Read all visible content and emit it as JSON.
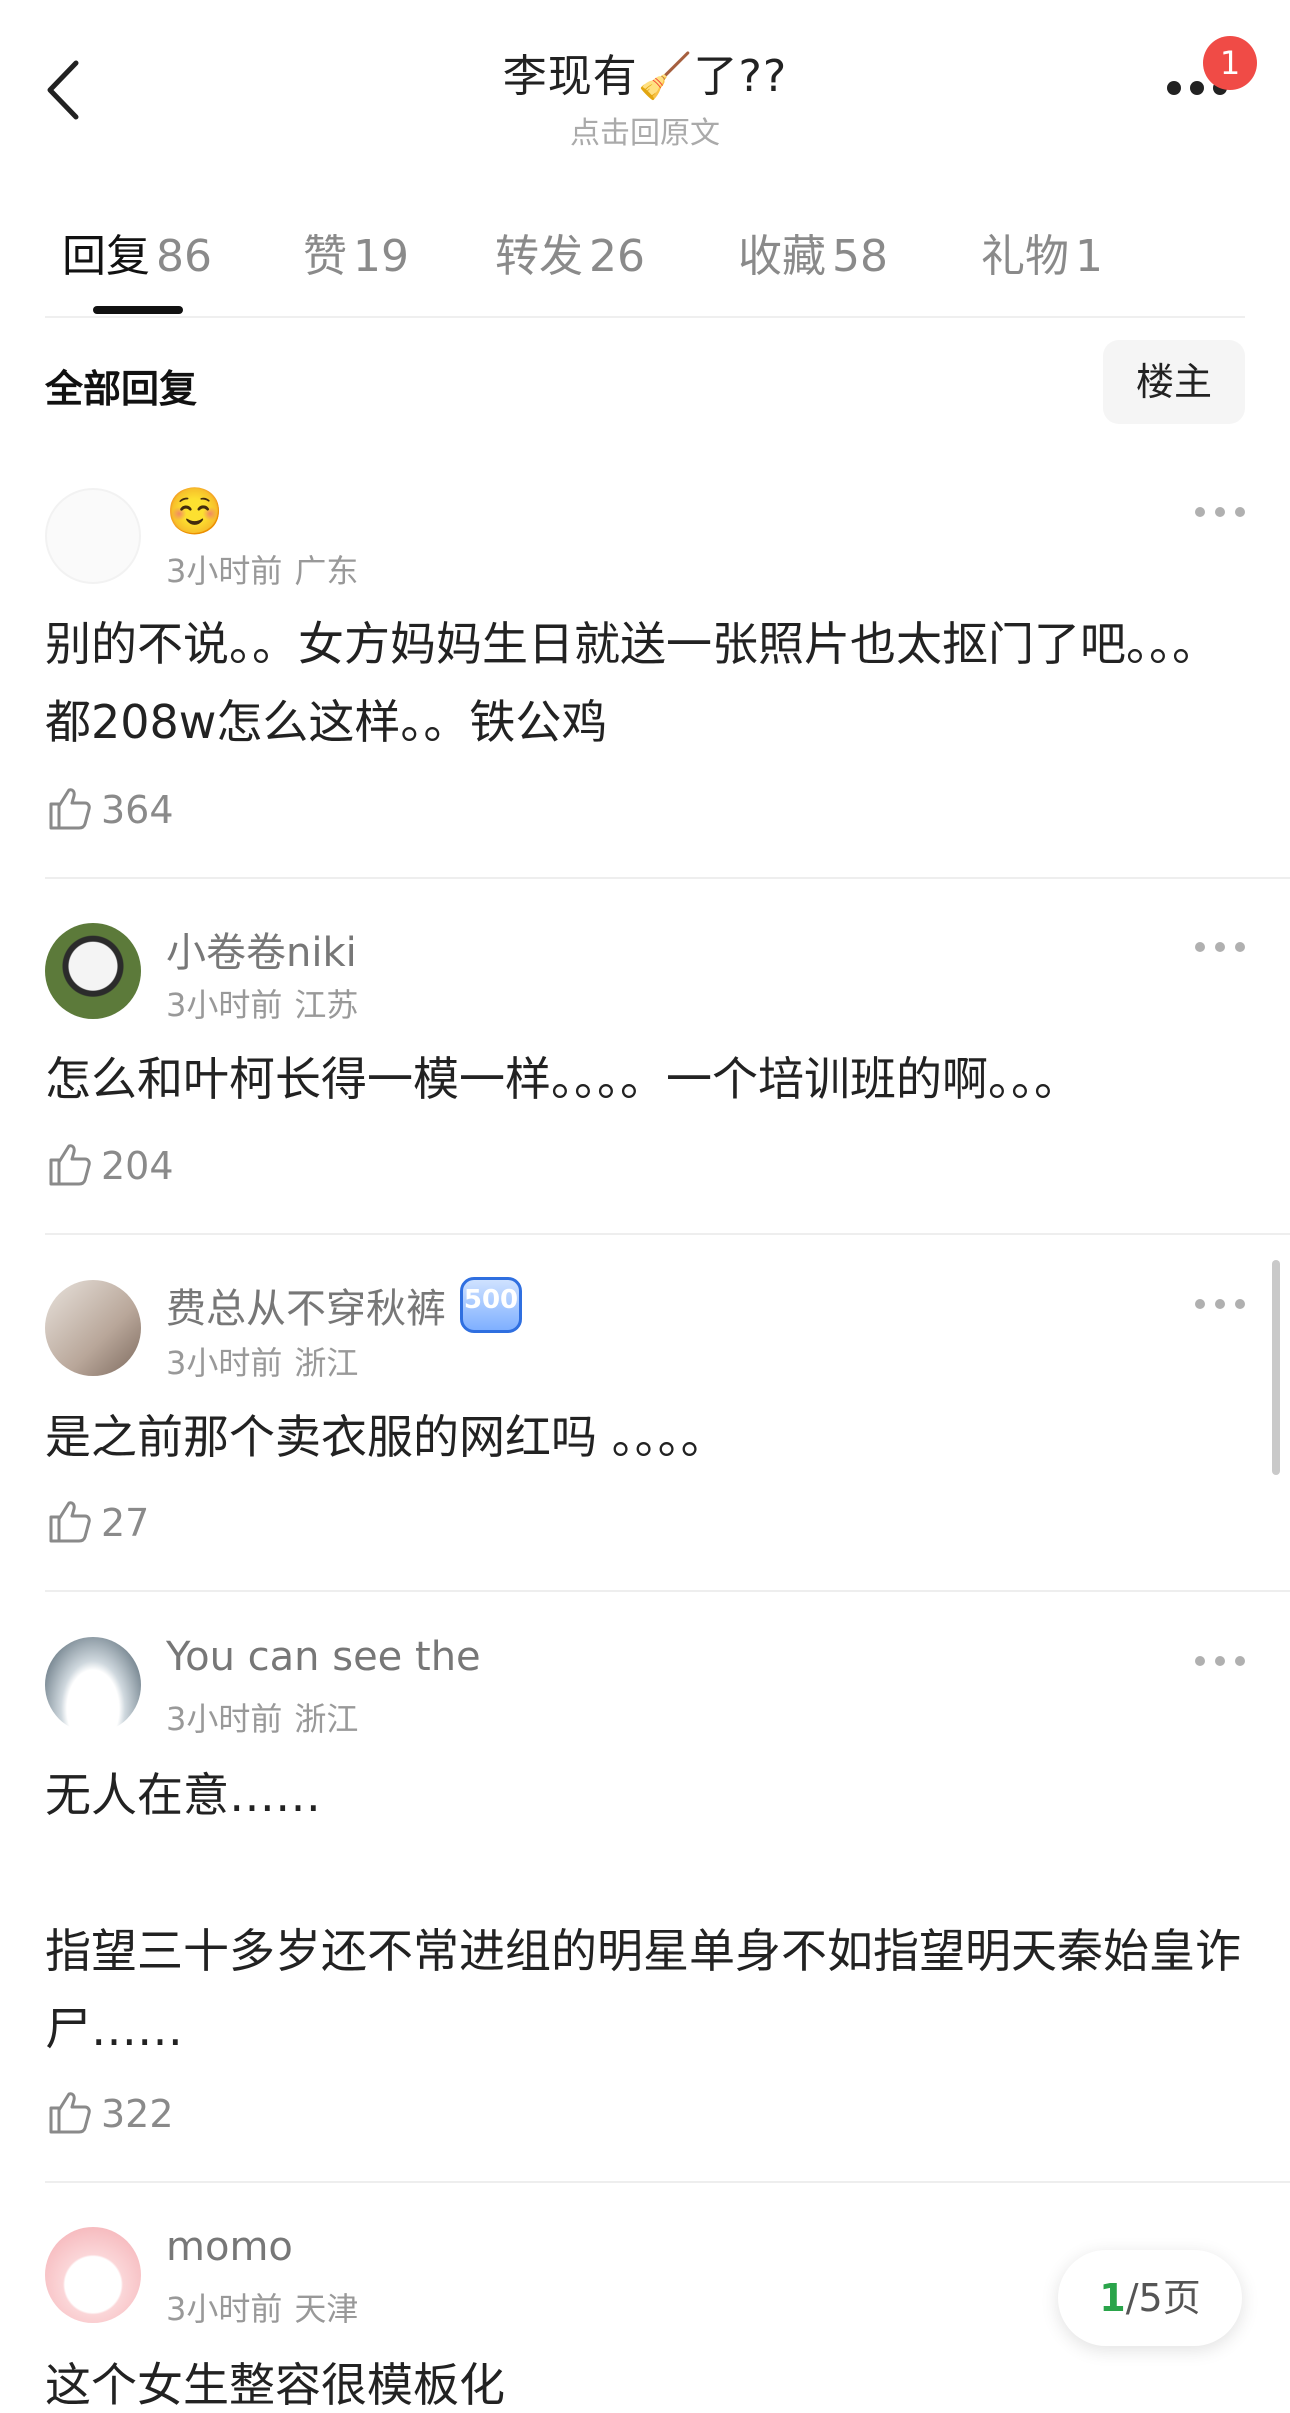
{
  "header": {
    "title": "李现有🧹了??",
    "subtitle": "点击回原文",
    "notification_count": "1"
  },
  "tabs": [
    {
      "label": "回复",
      "count": "86"
    },
    {
      "label": "赞",
      "count": "19"
    },
    {
      "label": "转发",
      "count": "26"
    },
    {
      "label": "收藏",
      "count": "58"
    },
    {
      "label": "礼物",
      "count": "1"
    }
  ],
  "filter": {
    "title": "全部回复",
    "op_button": "楼主"
  },
  "comments": [
    {
      "name": "☺️",
      "time": "3小时前",
      "location": "广东",
      "text": "别的不说。。女方妈妈生日就送一张照片也太抠门了吧。。。都208w怎么这样。。铁公鸡",
      "likes": "364"
    },
    {
      "name": "小卷卷niki",
      "time": "3小时前",
      "location": "江苏",
      "text": "怎么和叶柯长得一模一样。。。。一个培训班的啊。。。",
      "likes": "204"
    },
    {
      "name": "费总从不穿秋裤",
      "badge": "500",
      "time": "3小时前",
      "location": "浙江",
      "text": "是之前那个卖衣服的网红吗 。。。。",
      "likes": "27"
    },
    {
      "name": "You can see the",
      "time": "3小时前",
      "location": "浙江",
      "text": "无人在意……\n\n指望三十多岁还不常进组的明星单身不如指望明天秦始皇诈尸……",
      "likes": "322"
    },
    {
      "name": "momo",
      "time": "3小时前",
      "location": "天津",
      "text": "这个女生整容很模板化"
    }
  ],
  "pager": {
    "current": "1",
    "total_text": "/5页"
  }
}
